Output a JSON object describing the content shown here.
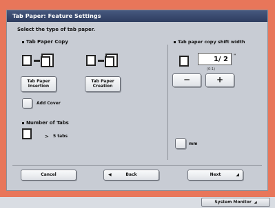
{
  "window": {
    "title": "Tab Paper: Feature Settings"
  },
  "instruction": "Select the type of tab paper.",
  "tab_paper_copy": {
    "heading": "Tab Paper Copy",
    "options": [
      {
        "label": "Tab Paper Insertion"
      },
      {
        "label": "Tab Paper Creation"
      }
    ],
    "add_cover_label": "Add Cover"
  },
  "number_of_tabs": {
    "heading": "Number of Tabs",
    "value": "5 tabs"
  },
  "shift_width": {
    "heading": "Tab paper copy shift width",
    "value": "1/ 2",
    "unit": "\"",
    "range": "(0-1)",
    "minus_label": "−",
    "plus_label": "+"
  },
  "mm_toggle": {
    "label": "mm"
  },
  "footer": {
    "cancel": "Cancel",
    "back": "Back",
    "next": "Next"
  },
  "system_monitor": "System Monitor"
}
